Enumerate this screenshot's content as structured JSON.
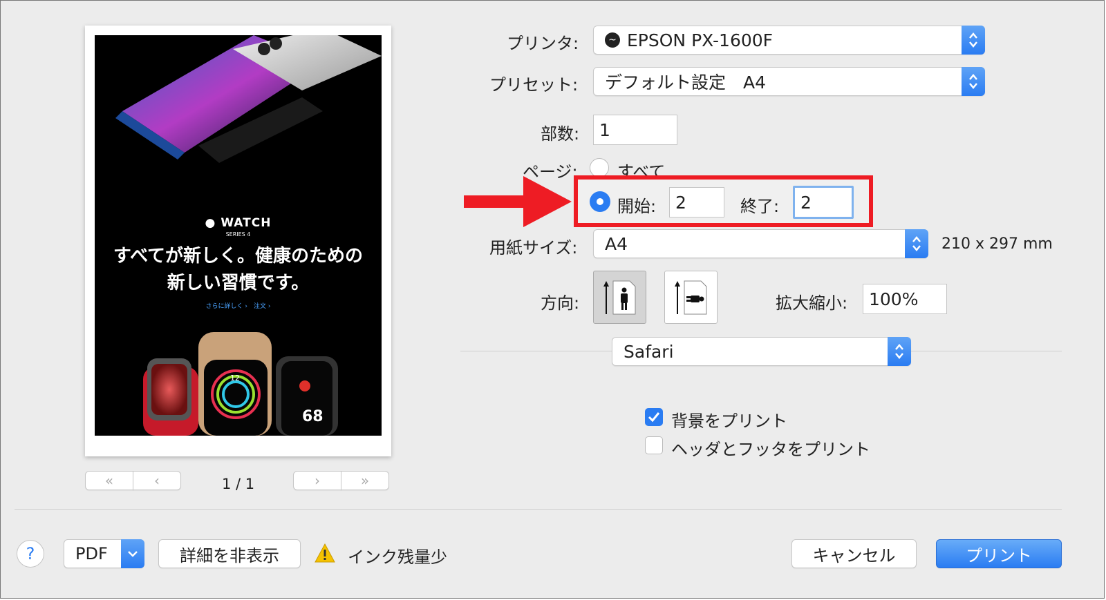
{
  "printer": {
    "label": "プリンタ:",
    "value": "EPSON PX-1600F"
  },
  "preset": {
    "label": "プリセット:",
    "value": "デフォルト設定　A4"
  },
  "copies": {
    "label": "部数:",
    "value": "1"
  },
  "pages": {
    "label": "ページ:",
    "all_label": "すべて",
    "from_label": "開始:",
    "from_value": "2",
    "to_label": "終了:",
    "to_value": "2"
  },
  "paper_size": {
    "label": "用紙サイズ:",
    "value": "A4",
    "dimensions": "210 x 297 mm"
  },
  "orientation": {
    "label": "方向:"
  },
  "scale": {
    "label": "拡大縮小:",
    "value": "100%"
  },
  "app_menu": {
    "value": "Safari"
  },
  "options": {
    "print_backgrounds": "背景をプリント",
    "print_headers": "ヘッダとフッタをプリント"
  },
  "preview": {
    "page_indicator": "1 / 1",
    "watch_brand": "WATCH",
    "watch_series": "SERIES 4",
    "headline_1": "すべてが新しく。健康のための",
    "headline_2": "新しい習慣です。",
    "links": "さらに詳しく ›　注文 ›",
    "watch_time": "12",
    "watch_bpm": "68"
  },
  "footer": {
    "help": "?",
    "pdf": "PDF",
    "details": "詳細を非表示",
    "warning": "インク残量少",
    "cancel": "キャンセル",
    "print": "プリント"
  },
  "colors": {
    "accent": "#2a7cf2",
    "annotation": "#ee1c24"
  }
}
